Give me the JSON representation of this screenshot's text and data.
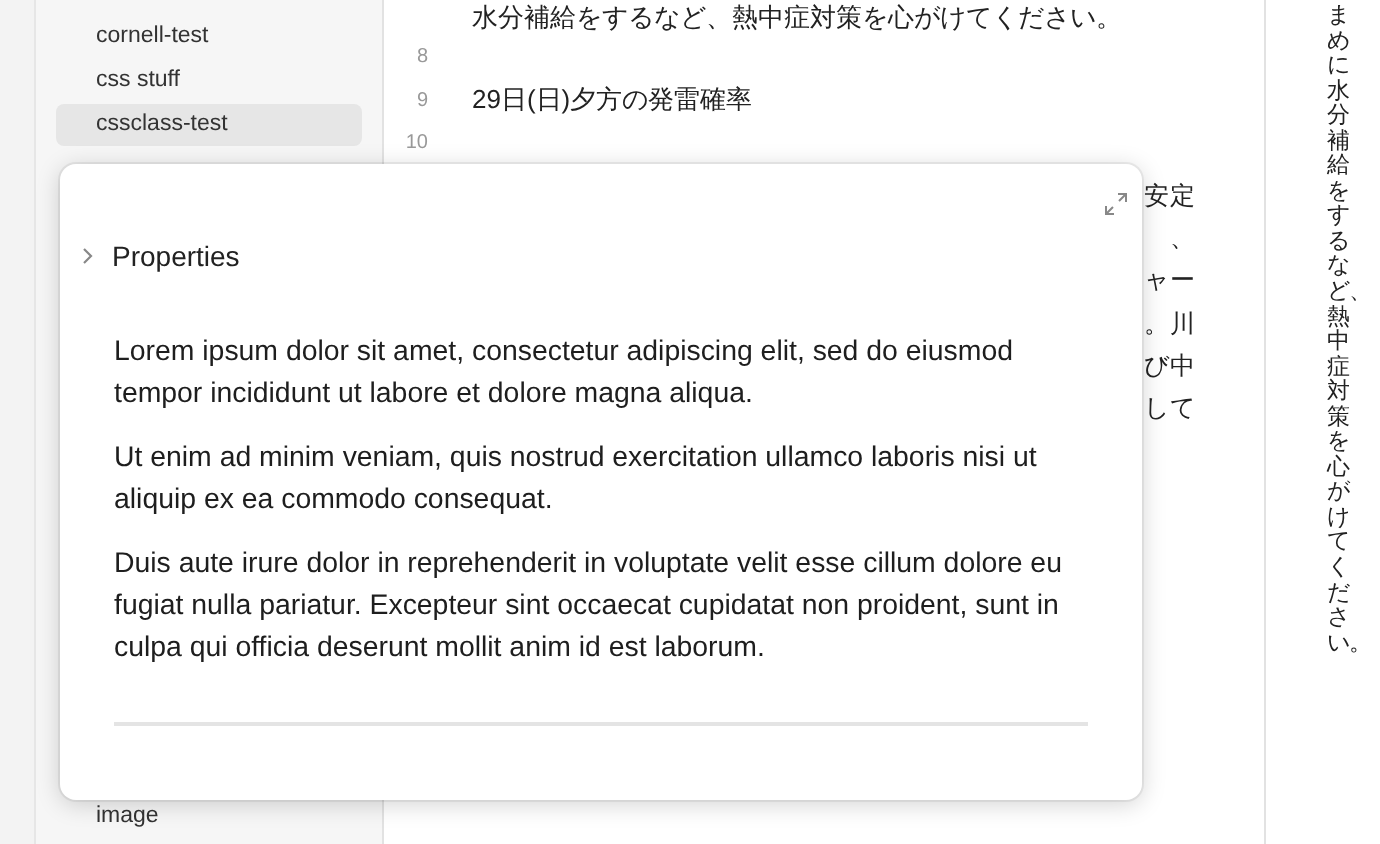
{
  "sidebar": {
    "items": [
      {
        "label": "cornell-test",
        "selected": false
      },
      {
        "label": "css stuff",
        "selected": false
      },
      {
        "label": "cssclass-test",
        "selected": true
      }
    ],
    "bottom_items": [
      {
        "label": "image",
        "selected": false
      }
    ]
  },
  "editor": {
    "lines": [
      {
        "text": "水分補給をするなど、熱中症対策を心がけてください。"
      },
      {
        "number": "8"
      },
      {
        "number": "9",
        "text": "29日(日)夕方の発雷確率"
      },
      {
        "number": "10"
      }
    ],
    "fragments": [
      "安定",
      "、",
      "ャー",
      "。川",
      "び中",
      "して"
    ]
  },
  "popover": {
    "properties": {
      "title": "Properties",
      "expanded": false
    },
    "paragraphs": [
      "Lorem ipsum dolor sit amet, consectetur adipiscing elit, sed do eiusmod tempor incididunt ut labore et dolore magna aliqua.",
      "Ut enim ad minim veniam, quis nostrud exercitation ullamco laboris nisi ut aliquip ex ea commodo consequat.",
      "Duis aute irure dolor in reprehenderit in voluptate velit esse cillum dolore eu fugiat nulla pariatur. Excepteur sint occaecat cupidatat non proident, sunt in culpa qui officia deserunt mollit anim id est laborum."
    ]
  },
  "right_panel": {
    "text": "まめに水分補給をするなど、熱中症対策を心がけてください。"
  }
}
